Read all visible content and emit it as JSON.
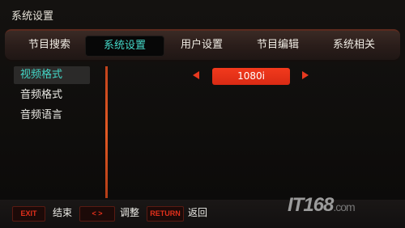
{
  "window": {
    "title": "系统设置"
  },
  "tabs": [
    {
      "label": "节目搜索"
    },
    {
      "label": "系统设置"
    },
    {
      "label": "用户设置"
    },
    {
      "label": "节目编辑"
    },
    {
      "label": "系统相关"
    }
  ],
  "active_tab": "系统设置",
  "sidebar": {
    "items": [
      {
        "label": "视频格式"
      },
      {
        "label": "音频格式"
      },
      {
        "label": "音频语言"
      }
    ],
    "active_item": "视频格式"
  },
  "setting": {
    "value": "1080i"
  },
  "footer": {
    "keys": [
      {
        "key": "EXIT",
        "action": "结束"
      },
      {
        "key": "< >",
        "action": "调整"
      },
      {
        "key": "RETURN",
        "action": "返回"
      }
    ]
  },
  "watermark": {
    "brand": "IT168",
    "domain": ".com"
  },
  "colors": {
    "accent_cyan": "#44d8c8",
    "accent_red": "#e8391f",
    "divider": "#e25a24"
  }
}
